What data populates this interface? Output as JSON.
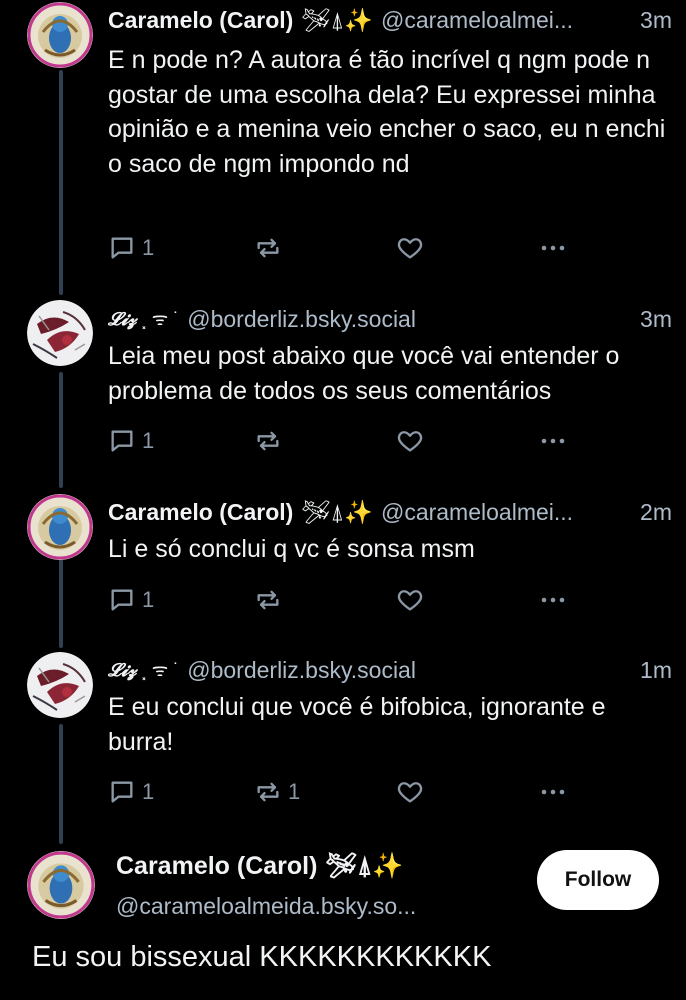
{
  "posts": [
    {
      "author": "Caramelo (Carol)",
      "decoration": "🛩⍋✨",
      "handle": "@carameloalmei...",
      "time": "3m",
      "text": "E n pode n? A autora é tão incrível q ngm pode n gostar de uma escolha dela? Eu expressei minha opinião e a menina veio encher o saco, eu n enchi o saco de ngm impondo nd",
      "replies": "1",
      "reposts": ""
    },
    {
      "author": "𝓛𝓲𝔃",
      "decoration": "⸼ ᯤ ˙",
      "handle": "@borderliz.bsky.social",
      "time": "3m",
      "text": "Leia meu post abaixo que você vai entender o problema de todos os seus comentários",
      "replies": "1",
      "reposts": ""
    },
    {
      "author": "Caramelo (Carol)",
      "decoration": "🛩⍋✨",
      "handle": "@carameloalmei...",
      "time": "2m",
      "text": "Li e só conclui q vc é sonsa msm",
      "replies": "1",
      "reposts": ""
    },
    {
      "author": "𝓛𝓲𝔃",
      "decoration": "⸼ ᯤ ˙",
      "handle": "@borderliz.bsky.social",
      "time": "1m",
      "text": "E eu conclui que você é bifobica, ignorante e burra!",
      "replies": "1",
      "reposts": "1"
    }
  ],
  "main_post": {
    "author": "Caramelo (Carol)",
    "decoration": "🛩⍋✨",
    "handle": "@carameloalmeida.bsky.so...",
    "follow_label": "Follow",
    "text": "Eu sou bissexual KKKKKKKKKKKK"
  },
  "icons": {
    "reply": "reply-icon",
    "repost": "repost-icon",
    "like": "heart-icon",
    "more": "more-icon"
  },
  "colors": {
    "background": "#000000",
    "text": "#f1f3f5",
    "muted": "#aebbc9",
    "thread_line": "#2e4052",
    "follow_button": "#ffffff"
  }
}
